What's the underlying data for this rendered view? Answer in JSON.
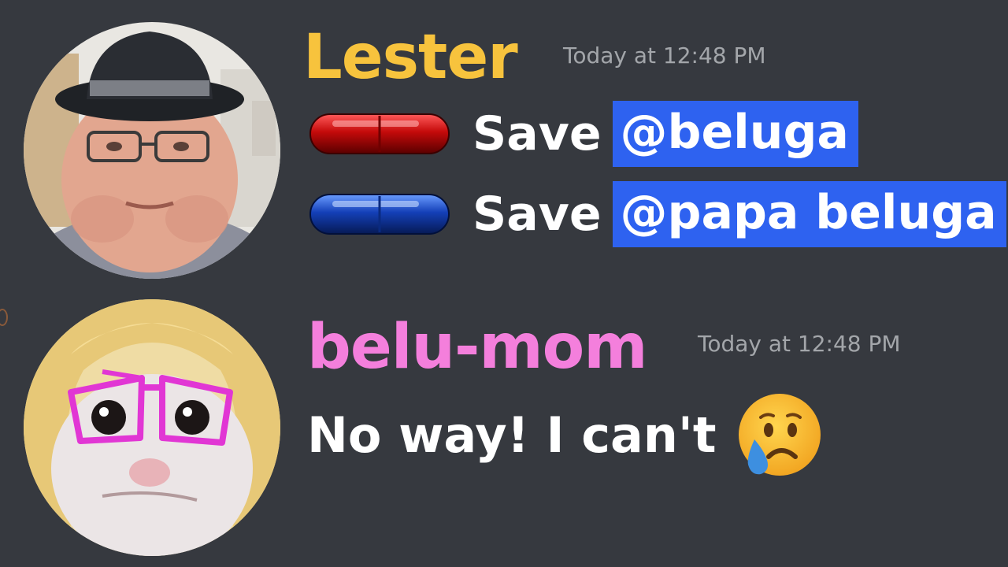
{
  "messages": [
    {
      "username": "Lester",
      "username_color": "#f7c33d",
      "timestamp": "Today at 12:48 PM",
      "avatar": "avatar-lester",
      "lines": [
        {
          "pill": "red-pill",
          "text": "Save",
          "mention": "@beluga"
        },
        {
          "pill": "blue-pill",
          "text": "Save",
          "mention": "@papa beluga"
        }
      ]
    },
    {
      "username": "belu-mom",
      "username_color": "#f47fdc",
      "timestamp": "Today at 12:48 PM",
      "avatar": "avatar-belu-mom",
      "text": "No way! I can't",
      "emoji": "crying-face-emoji"
    }
  ],
  "colors": {
    "background": "#36393f",
    "mention_highlight": "#2e62f0",
    "timestamp": "#a3a6aa"
  }
}
